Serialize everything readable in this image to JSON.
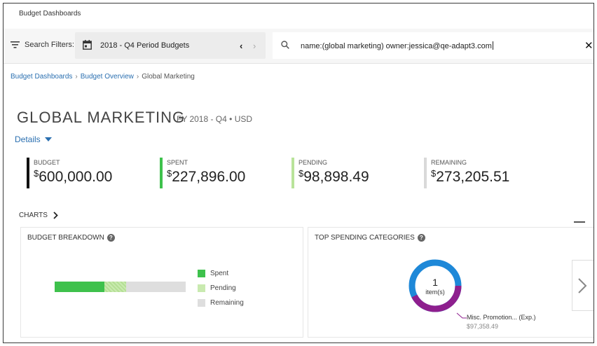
{
  "app": {
    "title": "Budget Dashboards"
  },
  "filters": {
    "label": "Search Filters:",
    "period": "2018 - Q4 Period Budgets",
    "prev_icon": "chevron-left-icon",
    "next_icon": "chevron-right-icon",
    "search_value": "name:(global marketing) owner:jessica@qe-adapt3.com",
    "clear_icon": "close-icon"
  },
  "breadcrumb": {
    "items": [
      "Budget Dashboards",
      "Budget Overview",
      "Global Marketing"
    ],
    "separator": "›"
  },
  "page": {
    "title": "GLOBAL MARKETING",
    "subtitle": "FY 2018 - Q4 • USD",
    "details_label": "Details"
  },
  "metrics": {
    "budget": {
      "label": "BUDGET",
      "currency": "$",
      "value": "600,000.00",
      "color": "#111111"
    },
    "spent": {
      "label": "SPENT",
      "currency": "$",
      "value": "227,896.00",
      "color": "#3ec14c"
    },
    "pending": {
      "label": "PENDING",
      "currency": "$",
      "value": "98,898.49",
      "color": "#b9e39a"
    },
    "remaining": {
      "label": "REMAINING",
      "currency": "$",
      "value": "273,205.51",
      "color": "#d9d9d9"
    }
  },
  "charts": {
    "header": "CHARTS",
    "budget_breakdown": {
      "title": "BUDGET BREAKDOWN",
      "legend": [
        "Spent",
        "Pending",
        "Remaining"
      ]
    },
    "top_spending": {
      "title": "TOP SPENDING CATEGORIES",
      "center_count": "1",
      "center_label": "item(s)",
      "category_name": "Misc. Promotion... (Exp.)",
      "category_amount": "$97,358.49"
    }
  },
  "chart_data": [
    {
      "type": "bar",
      "title": "BUDGET BREAKDOWN",
      "orientation": "horizontal-stacked",
      "categories": [
        "Spent",
        "Pending",
        "Remaining"
      ],
      "values": [
        227896.0,
        98898.49,
        273205.51
      ],
      "total": 600000.0,
      "colors": [
        "#3ec14c",
        "#c9eab0",
        "#dedede"
      ],
      "legend": "right"
    },
    {
      "type": "pie",
      "title": "TOP SPENDING CATEGORIES",
      "style": "donut",
      "slices": [
        {
          "name": "Misc. Promotion... (Exp.)",
          "value": 97358.49,
          "color": "#8e1f8e"
        }
      ],
      "track_value": 227896.0,
      "track_color": "#1e88d8"
    }
  ]
}
